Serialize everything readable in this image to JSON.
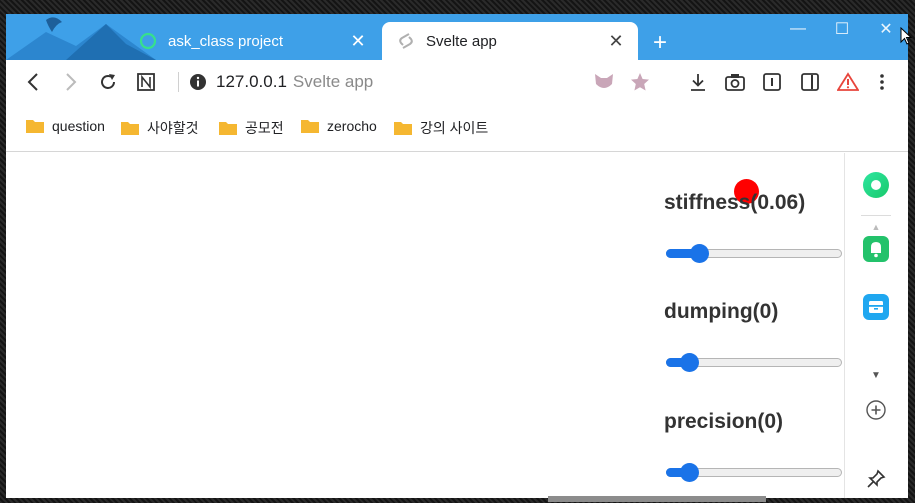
{
  "tabs": [
    {
      "title": "ask_class project",
      "active": false,
      "icon": "ring-icon"
    },
    {
      "title": "Svelte app",
      "active": true,
      "icon": "svelte-icon"
    }
  ],
  "window_controls": {
    "minimize": "—",
    "maximize": "☐",
    "close": "✕"
  },
  "new_tab_label": "+",
  "tab_close_label": "✕",
  "address_bar": {
    "host": "127.0.0.1",
    "page_title": "Svelte app"
  },
  "bookmarks": [
    "question",
    "사야할것",
    "공모전",
    "zerocho",
    "강의 사이트"
  ],
  "controls": [
    {
      "label": "stiffness(0.06)",
      "value": 0.06,
      "slider_fraction": 0.15
    },
    {
      "label": "dumping(0)",
      "value": 0,
      "slider_fraction": 0.09
    },
    {
      "label": "precision(0)",
      "value": 0,
      "slider_fraction": 0.09
    }
  ],
  "colors": {
    "tabstrip": "#3ea0e8",
    "accent": "#1a73e8",
    "dot": "#ff0000",
    "folder": "#f5b731"
  },
  "sidepanel_icons": [
    "green-circle-icon",
    "bell-icon",
    "archive-icon",
    "chevron-down-icon",
    "plus-icon",
    "pin-icon"
  ]
}
